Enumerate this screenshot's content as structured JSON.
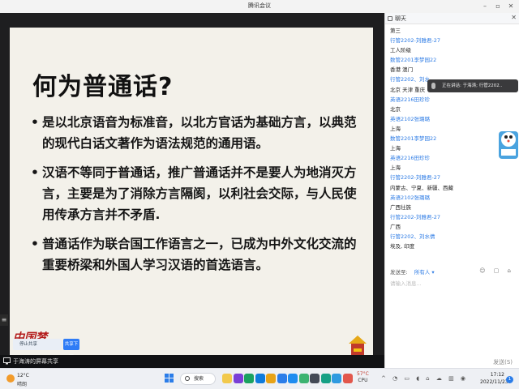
{
  "window": {
    "title": "腾讯会议",
    "controls": [
      "–",
      "▫",
      "✕"
    ]
  },
  "slide": {
    "title": "何为普通话?",
    "bullet_glyph": "•",
    "bullets": [
      "是以北京语音为标准音，以北方官话为基础方言，以典范的现代白话文著作为语法规范的通用语。",
      "汉语不等同于普通话，推广普通话并不是要人为地消灭方言，主要是为了消除方言隔阂，以利社会交际，与人民使用传承方言并不矛盾.",
      "普通话作为联合国工作语言之一，已成为中外文化交流的重要桥梁和外国人学习汉语的首选语言。"
    ],
    "logo_text": "中国梦"
  },
  "overlay": {
    "chip_label": "停止共享",
    "button_label": "共享下一"
  },
  "share_status": {
    "label": "于海涛的屏幕共享"
  },
  "chat": {
    "header": "聊天",
    "close": "✕",
    "messages": [
      {
        "kind": "text",
        "content": "第三"
      },
      {
        "kind": "sender",
        "content": "行管2202-刘雅君-27"
      },
      {
        "kind": "text",
        "content": "工人阶级"
      },
      {
        "kind": "sender",
        "content": "数管2201李梦园22"
      },
      {
        "kind": "text",
        "content": "香港 澳门"
      },
      {
        "kind": "sender",
        "content": "行管2202、刘水..."
      },
      {
        "kind": "text",
        "content": "北京 天津 重庆"
      },
      {
        "kind": "sender",
        "content": "英语2216田珍珍"
      },
      {
        "kind": "text",
        "content": "北京"
      },
      {
        "kind": "sender",
        "content": "英语2102张璐璐"
      },
      {
        "kind": "text",
        "content": "上海"
      },
      {
        "kind": "sender",
        "content": "数管2201李梦园22"
      },
      {
        "kind": "text",
        "content": "上海"
      },
      {
        "kind": "sender",
        "content": "英语2216田珍珍"
      },
      {
        "kind": "text",
        "content": "上海"
      },
      {
        "kind": "sender",
        "content": "行管2202-刘雅君-27"
      },
      {
        "kind": "text",
        "content": "内蒙古、宁夏、新疆、西藏"
      },
      {
        "kind": "sender",
        "content": "英语2102张璐璐"
      },
      {
        "kind": "text",
        "content": "广西壮族"
      },
      {
        "kind": "sender",
        "content": "行管2202-刘雅君-27"
      },
      {
        "kind": "text",
        "content": "广西"
      },
      {
        "kind": "sender",
        "content": "行管2202、刘水倩"
      },
      {
        "kind": "text",
        "content": "埃及, 印度"
      }
    ],
    "speaking_toast": "正在讲话: 于海涛; 行管2202..",
    "send_to_label": "发送至:",
    "send_to_value": "所有人",
    "send_to_caret": "▾",
    "tool_icons": "☺ ▢ ⌂",
    "input_placeholder": "请输入消息...",
    "send_button": "发送(S)"
  },
  "taskbar": {
    "weather_temp": "12°C",
    "weather_cond": "晴朗",
    "search_label": "搜索",
    "cpu_temp": "57°C",
    "cpu_label": "CPU",
    "tray_icons": "^ ◔ ▭ ◖ ⌂ ☁ ▥ ◉",
    "time": "17:12",
    "date": "2022/11/23",
    "notification_count": "1",
    "app_colors": [
      "#f2c94c",
      "#7a3fd6",
      "#1aa260",
      "#0f7bdc",
      "#e8a317",
      "#2b7de9",
      "#1f8cf0",
      "#3cb371",
      "#444a56",
      "#16a085",
      "#2f9ae0",
      "#e2574c"
    ]
  }
}
